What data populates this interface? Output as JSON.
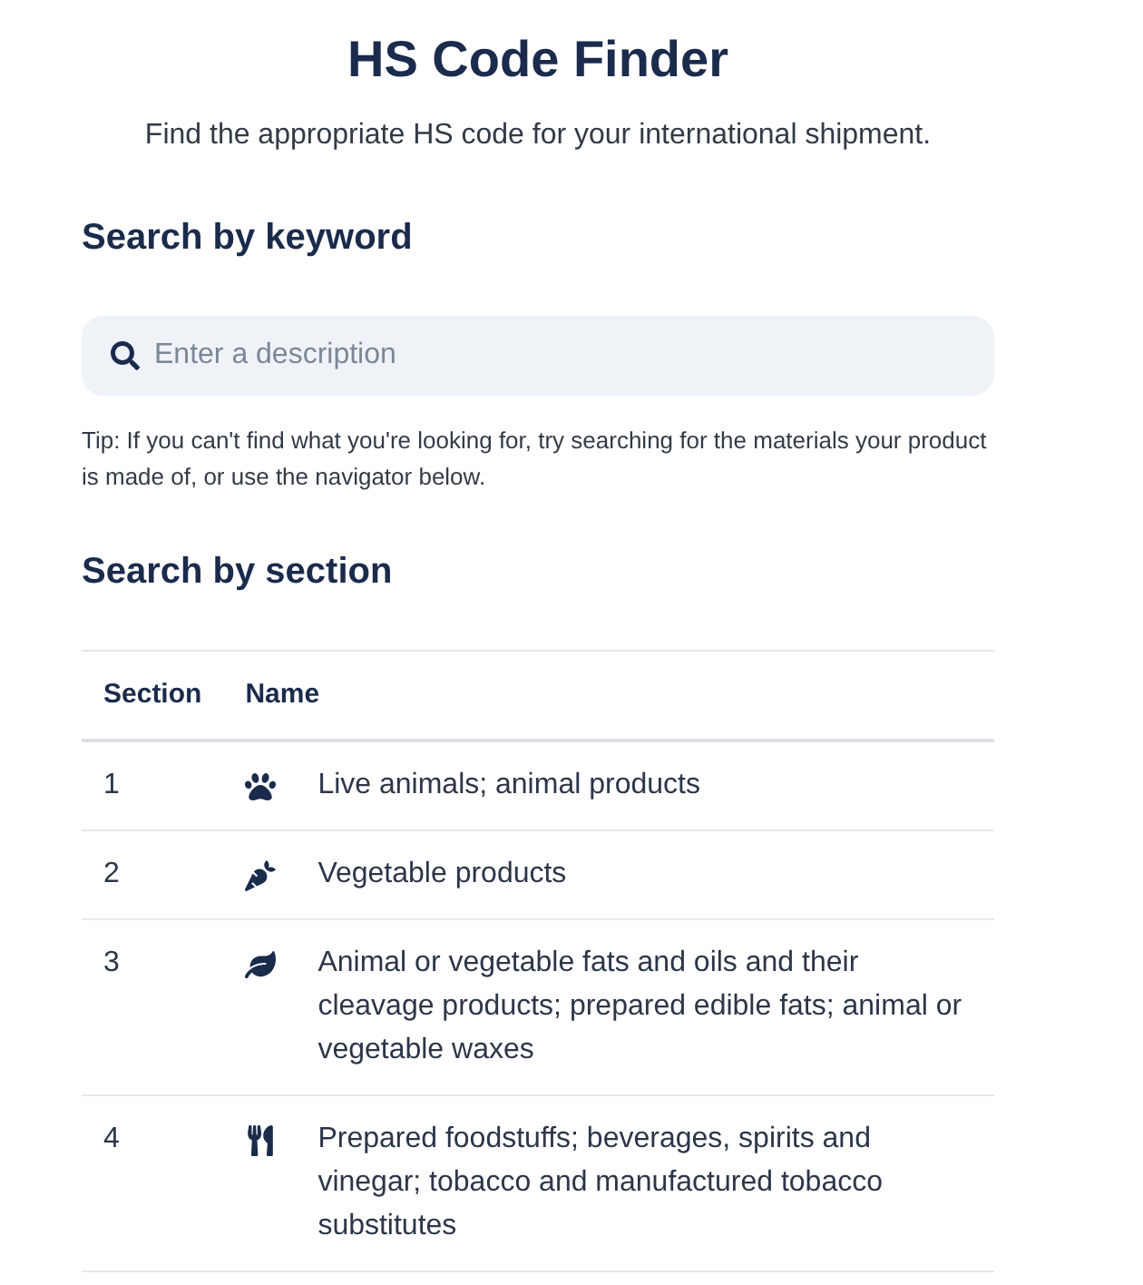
{
  "header": {
    "title": "HS Code Finder",
    "subtitle": "Find the appropriate HS code for your international shipment."
  },
  "keyword_search": {
    "heading": "Search by keyword",
    "search": {
      "placeholder": "Enter a description"
    },
    "tip": "Tip: If you can't find what you're looking for, try searching for the materials your product is made of, or use the navigator below."
  },
  "section_search": {
    "heading": "Search by section",
    "table": {
      "columns": [
        "Section",
        "Name"
      ],
      "rows": [
        {
          "section": "1",
          "name": "Live animals; animal products"
        },
        {
          "section": "2",
          "name": "Vegetable products"
        },
        {
          "section": "3",
          "name": "Animal or vegetable fats and oils and their cleavage products; prepared edible fats; animal or vegetable waxes"
        },
        {
          "section": "4",
          "name": "Prepared foodstuffs; beverages, spirits and vinegar; tobacco and manufactured tobacco substitutes"
        }
      ]
    }
  }
}
